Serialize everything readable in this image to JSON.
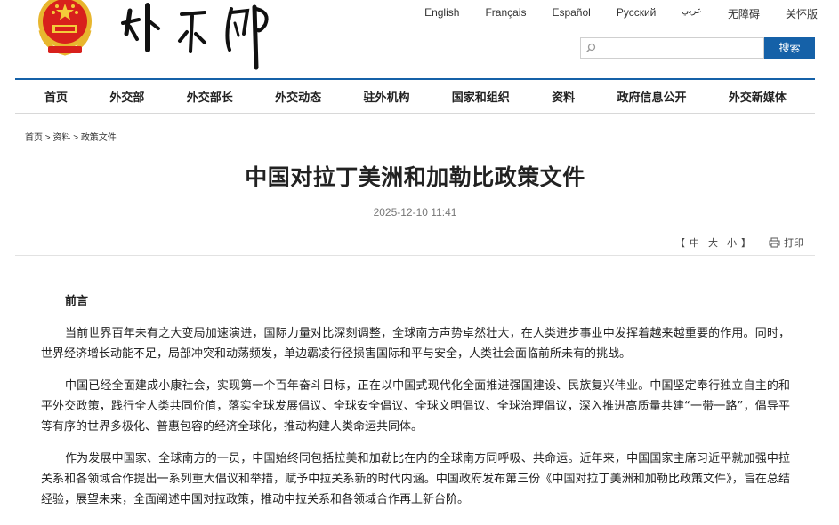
{
  "header": {
    "emblem_icon": "national-emblem-icon",
    "logo_text": "外交部",
    "languages": [
      "English",
      "Français",
      "Español",
      "Русский",
      "عربي",
      "无障碍",
      "关怀版"
    ]
  },
  "search": {
    "placeholder": "",
    "button_label": "搜索"
  },
  "nav": {
    "items": [
      "首页",
      "外交部",
      "外交部长",
      "外交动态",
      "驻外机构",
      "国家和组织",
      "资料",
      "政府信息公开",
      "外交新媒体"
    ]
  },
  "breadcrumb": {
    "items": [
      "首页",
      "资料",
      "政策文件"
    ],
    "separator": ">"
  },
  "article": {
    "title": "中国对拉丁美洲和加勒比政策文件",
    "date": "2025-12-10 11:41",
    "font_size_label_open": "【",
    "font_sizes": [
      "中",
      "大",
      "小"
    ],
    "font_size_label_close": "】",
    "print_label": "打印",
    "section_heading": "前言",
    "paragraphs": [
      "当前世界百年未有之大变局加速演进，国际力量对比深刻调整，全球南方声势卓然壮大，在人类进步事业中发挥着越来越重要的作用。同时，世界经济增长动能不足，局部冲突和动荡频发，单边霸凌行径损害国际和平与安全，人类社会面临前所未有的挑战。",
      "中国已经全面建成小康社会，实现第一个百年奋斗目标，正在以中国式现代化全面推进强国建设、民族复兴伟业。中国坚定奉行独立自主的和平外交政策，践行全人类共同价值，落实全球发展倡议、全球安全倡议、全球文明倡议、全球治理倡议，深入推进高质量共建“一带一路”，倡导平等有序的世界多极化、普惠包容的经济全球化，推动构建人类命运共同体。",
      "作为发展中国家、全球南方的一员，中国始终同包括拉美和加勒比在内的全球南方同呼吸、共命运。近年来，中国国家主席习近平就加强中拉关系和各领域合作提出一系列重大倡议和举措，赋予中拉关系新的时代内涵。中国政府发布第三份《中国对拉丁美洲和加勒比政策文件》，旨在总结经验，展望未来，全面阐述中国对拉政策，推动中拉关系和各领域合作再上新台阶。"
    ]
  },
  "colors": {
    "accent": "#1561a8",
    "emblem_red": "#d8201c",
    "emblem_gold": "#e8b62e"
  }
}
